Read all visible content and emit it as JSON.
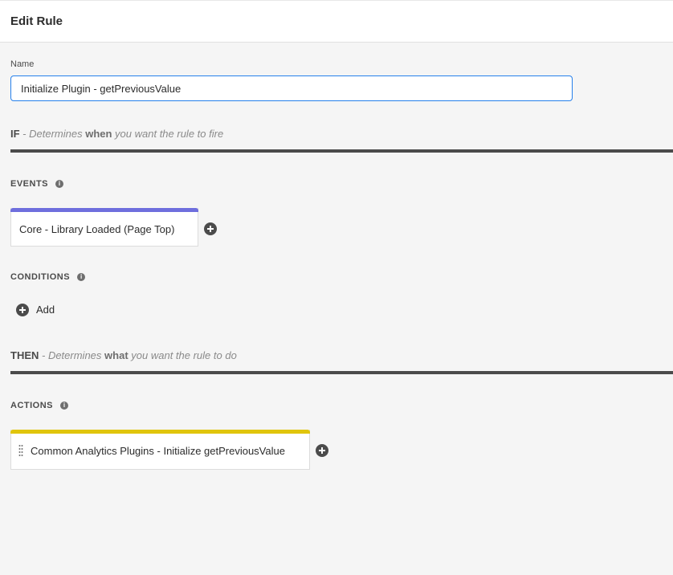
{
  "header": {
    "title": "Edit Rule"
  },
  "name_field": {
    "label": "Name",
    "value": "Initialize Plugin - getPreviousValue"
  },
  "if_section": {
    "keyword": "IF",
    "desc_prefix": " - Determines ",
    "desc_emphasis": "when",
    "desc_suffix": " you want the rule to fire"
  },
  "events": {
    "label": "EVENTS",
    "items": [
      {
        "label": "Core - Library Loaded (Page Top)",
        "color": "#6e6edd"
      }
    ]
  },
  "conditions": {
    "label": "CONDITIONS",
    "add_label": "Add"
  },
  "then_section": {
    "keyword": "THEN",
    "desc_prefix": " - Determines ",
    "desc_emphasis": "what",
    "desc_suffix": " you want the rule to do"
  },
  "actions": {
    "label": "ACTIONS",
    "items": [
      {
        "label": "Common Analytics Plugins - Initialize getPreviousValue",
        "color": "#e0c50d"
      }
    ]
  },
  "icons": {
    "info": "info-icon",
    "add": "plus-circle-icon",
    "drag": "drag-handle-icon"
  }
}
